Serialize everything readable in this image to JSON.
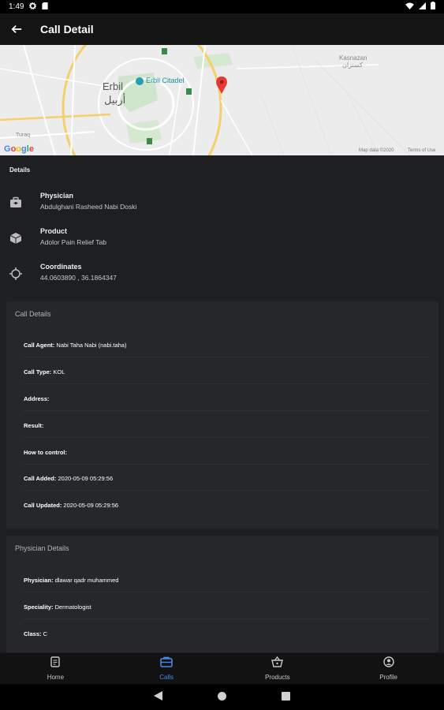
{
  "status_bar": {
    "time": "1:49"
  },
  "app_bar": {
    "title": "Call Detail"
  },
  "map": {
    "city_en": "Erbil",
    "city_ar": "أربيل",
    "poi": "Erbil Citadel",
    "district_en": "Kasnazan",
    "district_ar": "كسنزان",
    "village": "Turaq",
    "attribution": "Map data ©2020",
    "terms": "Terms of Use",
    "google": "Google"
  },
  "details": {
    "header": "Details",
    "rows": [
      {
        "icon": "briefcase-icon",
        "label": "Physician",
        "value": "Abdulghani Rasheed Nabi Doski"
      },
      {
        "icon": "cube-icon",
        "label": "Product",
        "value": "Adolor Pain Relief Tab"
      },
      {
        "icon": "crosshair-icon",
        "label": "Coordinates",
        "value": "44.0603890 , 36.1864347"
      }
    ]
  },
  "call_details": {
    "title": "Call Details",
    "rows": [
      {
        "key": "Call Agent:",
        "value": " Nabi Taha Nabi (nabi.taha)"
      },
      {
        "key": "Call Type:",
        "value": " KOL"
      },
      {
        "key": "Address:",
        "value": ""
      },
      {
        "key": "Result:",
        "value": ""
      },
      {
        "key": "How to control:",
        "value": ""
      },
      {
        "key": "Call Added:",
        "value": " 2020-05-09 05:29:56"
      },
      {
        "key": "Call Updated:",
        "value": " 2020-05-09 05:29:56"
      }
    ]
  },
  "physician_details": {
    "title": "Physician Details",
    "rows": [
      {
        "key": "Physician:",
        "value": " dlawar qadr muhammed"
      },
      {
        "key": "Speciality:",
        "value": " Dermatologist"
      },
      {
        "key": "Class:",
        "value": " C"
      }
    ]
  },
  "bottom_nav": {
    "items": [
      {
        "label": "Home",
        "icon": "document-icon",
        "active": false
      },
      {
        "label": "Calls",
        "icon": "calls-icon",
        "active": true
      },
      {
        "label": "Products",
        "icon": "basket-icon",
        "active": false
      },
      {
        "label": "Profile",
        "icon": "profile-icon",
        "active": false
      }
    ]
  },
  "colors": {
    "accent": "#4a8df0",
    "background": "#1e1f22",
    "card": "#26272b",
    "pin": "#e53935"
  }
}
